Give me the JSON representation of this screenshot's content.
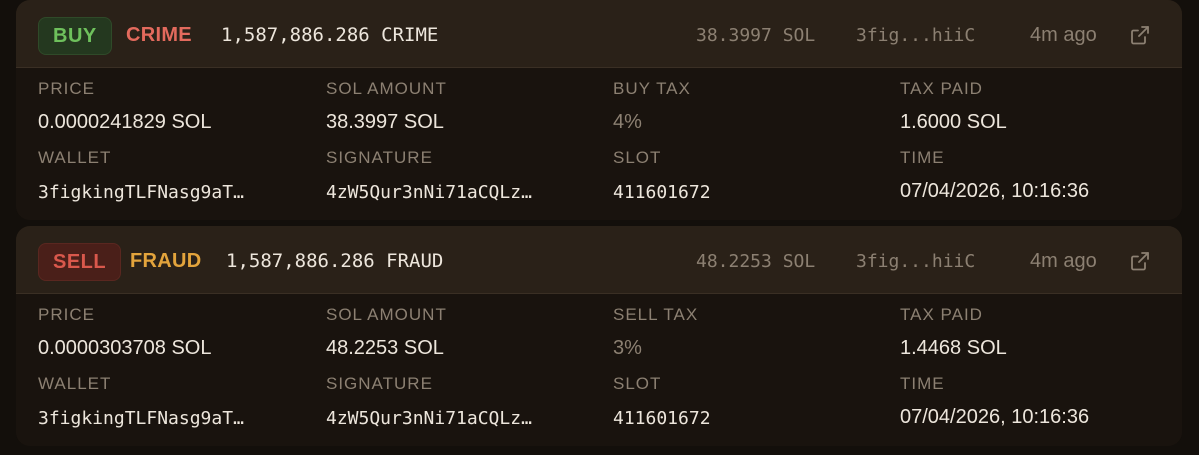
{
  "colors": {
    "buy_green": "#6ec05c",
    "sell_red": "#d9584c",
    "crime_token": "#e36a5d",
    "fraud_token": "#e3a43c",
    "muted_text": "#8c8072",
    "primary_text": "#ede6dc"
  },
  "trades": [
    {
      "side": "BUY",
      "token": "CRIME",
      "amount": "1,587,886.286 CRIME",
      "sol": "38.3997 SOL",
      "wallet_short": "3fig...hiiC",
      "ago": "4m ago",
      "link_icon": "external-link-icon",
      "price_label": "PRICE",
      "price": "0.0000241829 SOL",
      "sol_amount_label": "SOL AMOUNT",
      "sol_amount": "38.3997 SOL",
      "tax_label": "BUY TAX",
      "tax": "4%",
      "tax_paid_label": "TAX PAID",
      "tax_paid": "1.6000 SOL",
      "wallet_label": "WALLET",
      "wallet": "3figkingTLFNasg9aT…",
      "signature_label": "SIGNATURE",
      "signature": "4zW5Qur3nNi71aCQLz…",
      "slot_label": "SLOT",
      "slot": "411601672",
      "time_label": "TIME",
      "time": "07/04/2026, 10:16:36"
    },
    {
      "side": "SELL",
      "token": "FRAUD",
      "amount": "1,587,886.286 FRAUD",
      "sol": "48.2253 SOL",
      "wallet_short": "3fig...hiiC",
      "ago": "4m ago",
      "link_icon": "external-link-icon",
      "price_label": "PRICE",
      "price": "0.0000303708 SOL",
      "sol_amount_label": "SOL AMOUNT",
      "sol_amount": "48.2253 SOL",
      "tax_label": "SELL TAX",
      "tax": "3%",
      "tax_paid_label": "TAX PAID",
      "tax_paid": "1.4468 SOL",
      "wallet_label": "WALLET",
      "wallet": "3figkingTLFNasg9aT…",
      "signature_label": "SIGNATURE",
      "signature": "4zW5Qur3nNi71aCQLz…",
      "slot_label": "SLOT",
      "slot": "411601672",
      "time_label": "TIME",
      "time": "07/04/2026, 10:16:36"
    }
  ]
}
